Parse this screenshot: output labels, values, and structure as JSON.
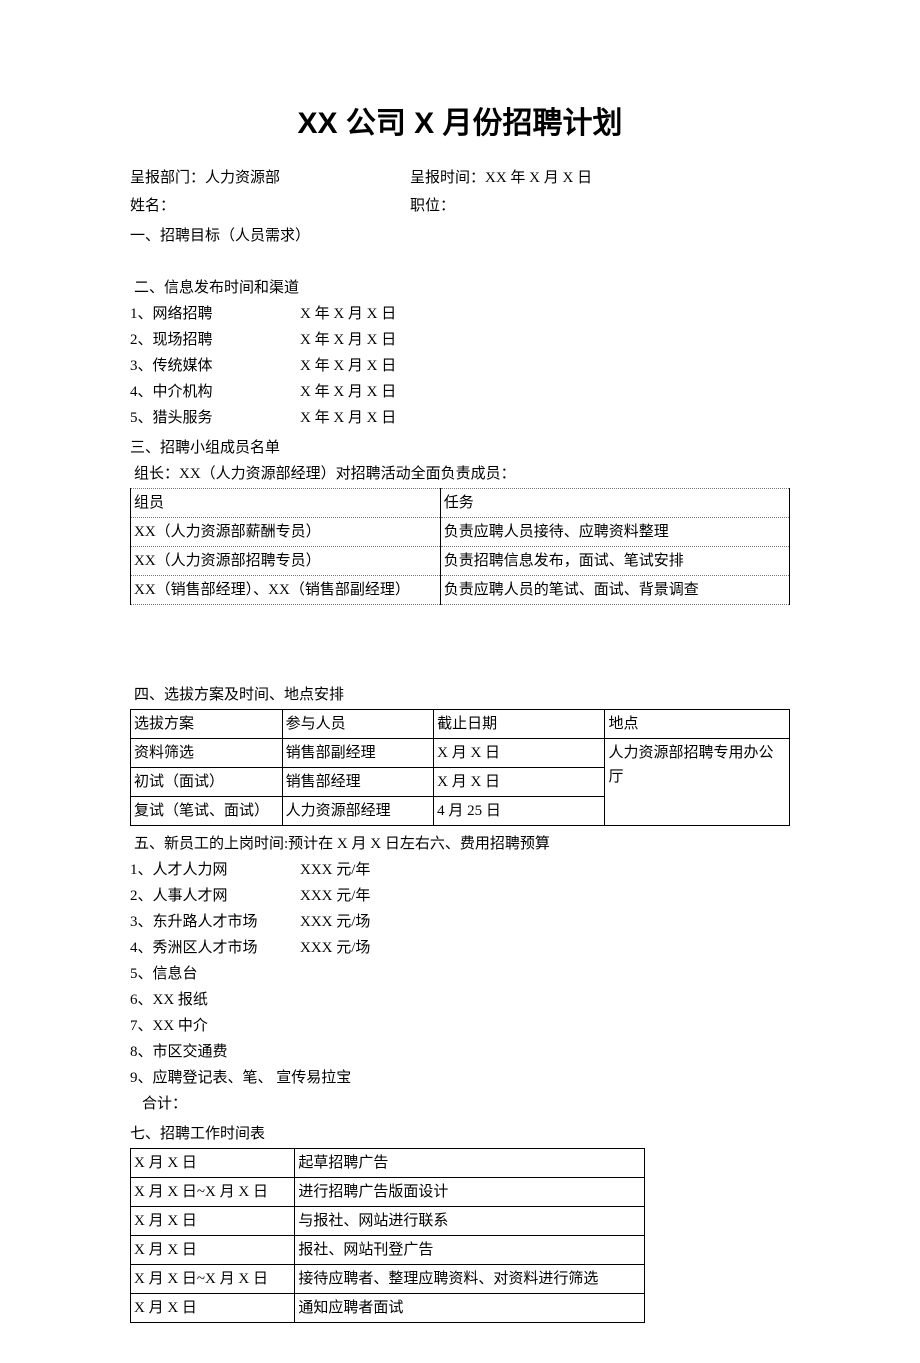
{
  "title": "XX 公司 X 月份招聘计划",
  "meta": {
    "dept_label": "呈报部门：人力资源部",
    "time_label": "呈报时间：XX 年 X 月 X 日",
    "name_label": "姓名：",
    "pos_label": "职位："
  },
  "s1": {
    "title": "一、招聘目标（人员需求）"
  },
  "s2": {
    "title": "二、信息发布时间和渠道",
    "items": [
      {
        "label": "1、网络招聘",
        "date": "X 年 X 月 X 日"
      },
      {
        "label": "2、现场招聘",
        "date": "X 年 X 月 X 日"
      },
      {
        "label": "3、传统媒体",
        "date": "X 年 X 月 X 日"
      },
      {
        "label": "4、中介机构",
        "date": "X 年 X 月 X 日"
      },
      {
        "label": "5、猎头服务",
        "date": "X 年 X 月 X 日"
      }
    ]
  },
  "s3": {
    "title": "三、招聘小组成员名单",
    "leader": "组长：XX（人力资源部经理）对招聘活动全面负责成员：",
    "header": {
      "member": "组员",
      "task": "任务"
    },
    "rows": [
      {
        "member": "XX（人力资源部薪酬专员）",
        "task": "负责应聘人员接待、应聘资料整理"
      },
      {
        "member": "XX（人力资源部招聘专员）",
        "task": "负责招聘信息发布，面试、笔试安排"
      },
      {
        "member": "XX（销售部经理）、XX（销售部副经理）",
        "task": "负责应聘人员的笔试、面试、背景调查"
      }
    ]
  },
  "s4": {
    "title": "四、选拔方案及时间、地点安排",
    "header": {
      "plan": "选拔方案",
      "people": "参与人员",
      "deadline": "截止日期",
      "place": "地点"
    },
    "rows": [
      {
        "plan": "资料筛选",
        "people": "销售部副经理",
        "deadline": "X 月 X 日"
      },
      {
        "plan": "初试（面试）",
        "people": "销售部经理",
        "deadline": "X 月 X 日"
      },
      {
        "plan": "复试（笔试、面试）",
        "people": "人力资源部经理",
        "deadline": "4 月 25 日"
      }
    ],
    "place": "人力资源部招聘专用办公厅"
  },
  "s5": {
    "title": "五、新员工的上岗时间:预计在 X 月 X 日左右六、费用招聘预算",
    "items": [
      {
        "label": "1、人才人力网",
        "amount": "XXX 元/年"
      },
      {
        "label": "2、人事人才网",
        "amount": "XXX 元/年"
      },
      {
        "label": "3、东升路人才市场",
        "amount": "XXX 元/场"
      },
      {
        "label": "4、秀洲区人才市场",
        "amount": "XXX 元/场"
      },
      {
        "label": "5、信息台",
        "amount": ""
      },
      {
        "label": "6、XX 报纸",
        "amount": ""
      },
      {
        "label": "7、XX 中介",
        "amount": ""
      },
      {
        "label": "8、市区交通费",
        "amount": ""
      },
      {
        "label": "9、应聘登记表、笔、     宣传易拉宝",
        "amount": ""
      }
    ],
    "total": "合计："
  },
  "s7": {
    "title": "七、招聘工作时间表",
    "rows": [
      {
        "date": "X 月 X 日",
        "task": "起草招聘广告"
      },
      {
        "date": "X 月 X 日~X 月 X 日",
        "task": "进行招聘广告版面设计"
      },
      {
        "date": "X 月 X 日",
        "task": "与报社、网站进行联系"
      },
      {
        "date": "X 月 X 日",
        "task": "报社、网站刊登广告"
      },
      {
        "date": "X 月 X 日~X 月 X 日",
        "task": "接待应聘者、整理应聘资料、对资料进行筛选"
      },
      {
        "date": "X 月 X 日",
        "task": "通知应聘者面试"
      }
    ]
  }
}
